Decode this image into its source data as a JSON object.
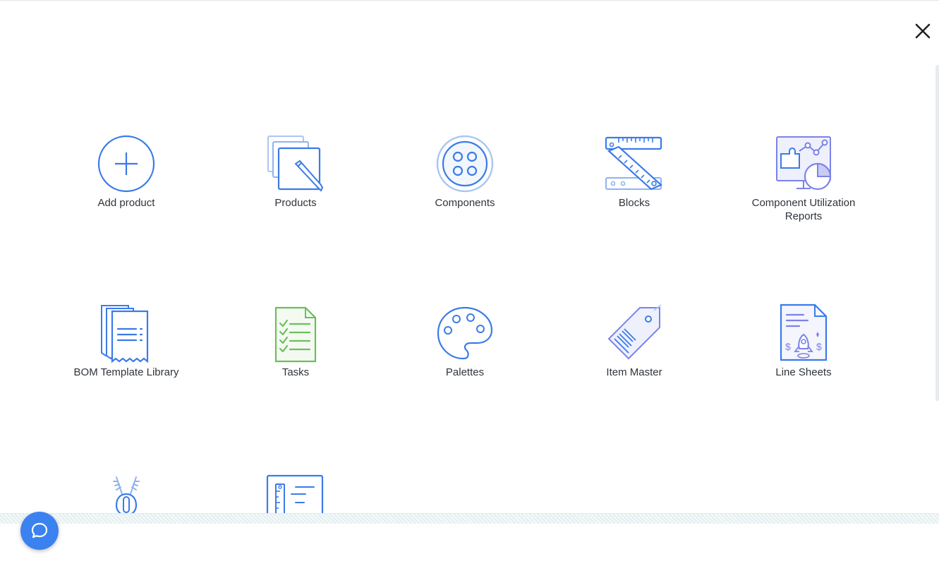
{
  "modal": {
    "close_label": "close"
  },
  "tiles": [
    {
      "label": "Add product",
      "icon": "add-circle-icon"
    },
    {
      "label": "Products",
      "icon": "products-pencil-icon"
    },
    {
      "label": "Components",
      "icon": "components-button-icon"
    },
    {
      "label": "Blocks",
      "icon": "rulers-icon"
    },
    {
      "label": "Component Utilization Reports",
      "icon": "utilization-report-icon"
    },
    {
      "label": "BOM Template Library",
      "icon": "bom-template-icon"
    },
    {
      "label": "Tasks",
      "icon": "task-checklist-icon"
    },
    {
      "label": "Palettes",
      "icon": "palette-icon"
    },
    {
      "label": "Item Master",
      "icon": "barcode-tag-icon"
    },
    {
      "label": "Line Sheets",
      "icon": "line-sheet-icon"
    },
    {
      "label": "",
      "icon": "zipper-icon"
    },
    {
      "label": "",
      "icon": "spec-sheet-icon"
    }
  ],
  "colors": {
    "accent": "#3b7be8",
    "accent_light": "#aac6f3",
    "green": "#6cbf5a",
    "violet": "#7b82e8",
    "chat": "#3b82f0"
  },
  "chat_widget": {
    "icon": "chat-bubble-icon"
  }
}
